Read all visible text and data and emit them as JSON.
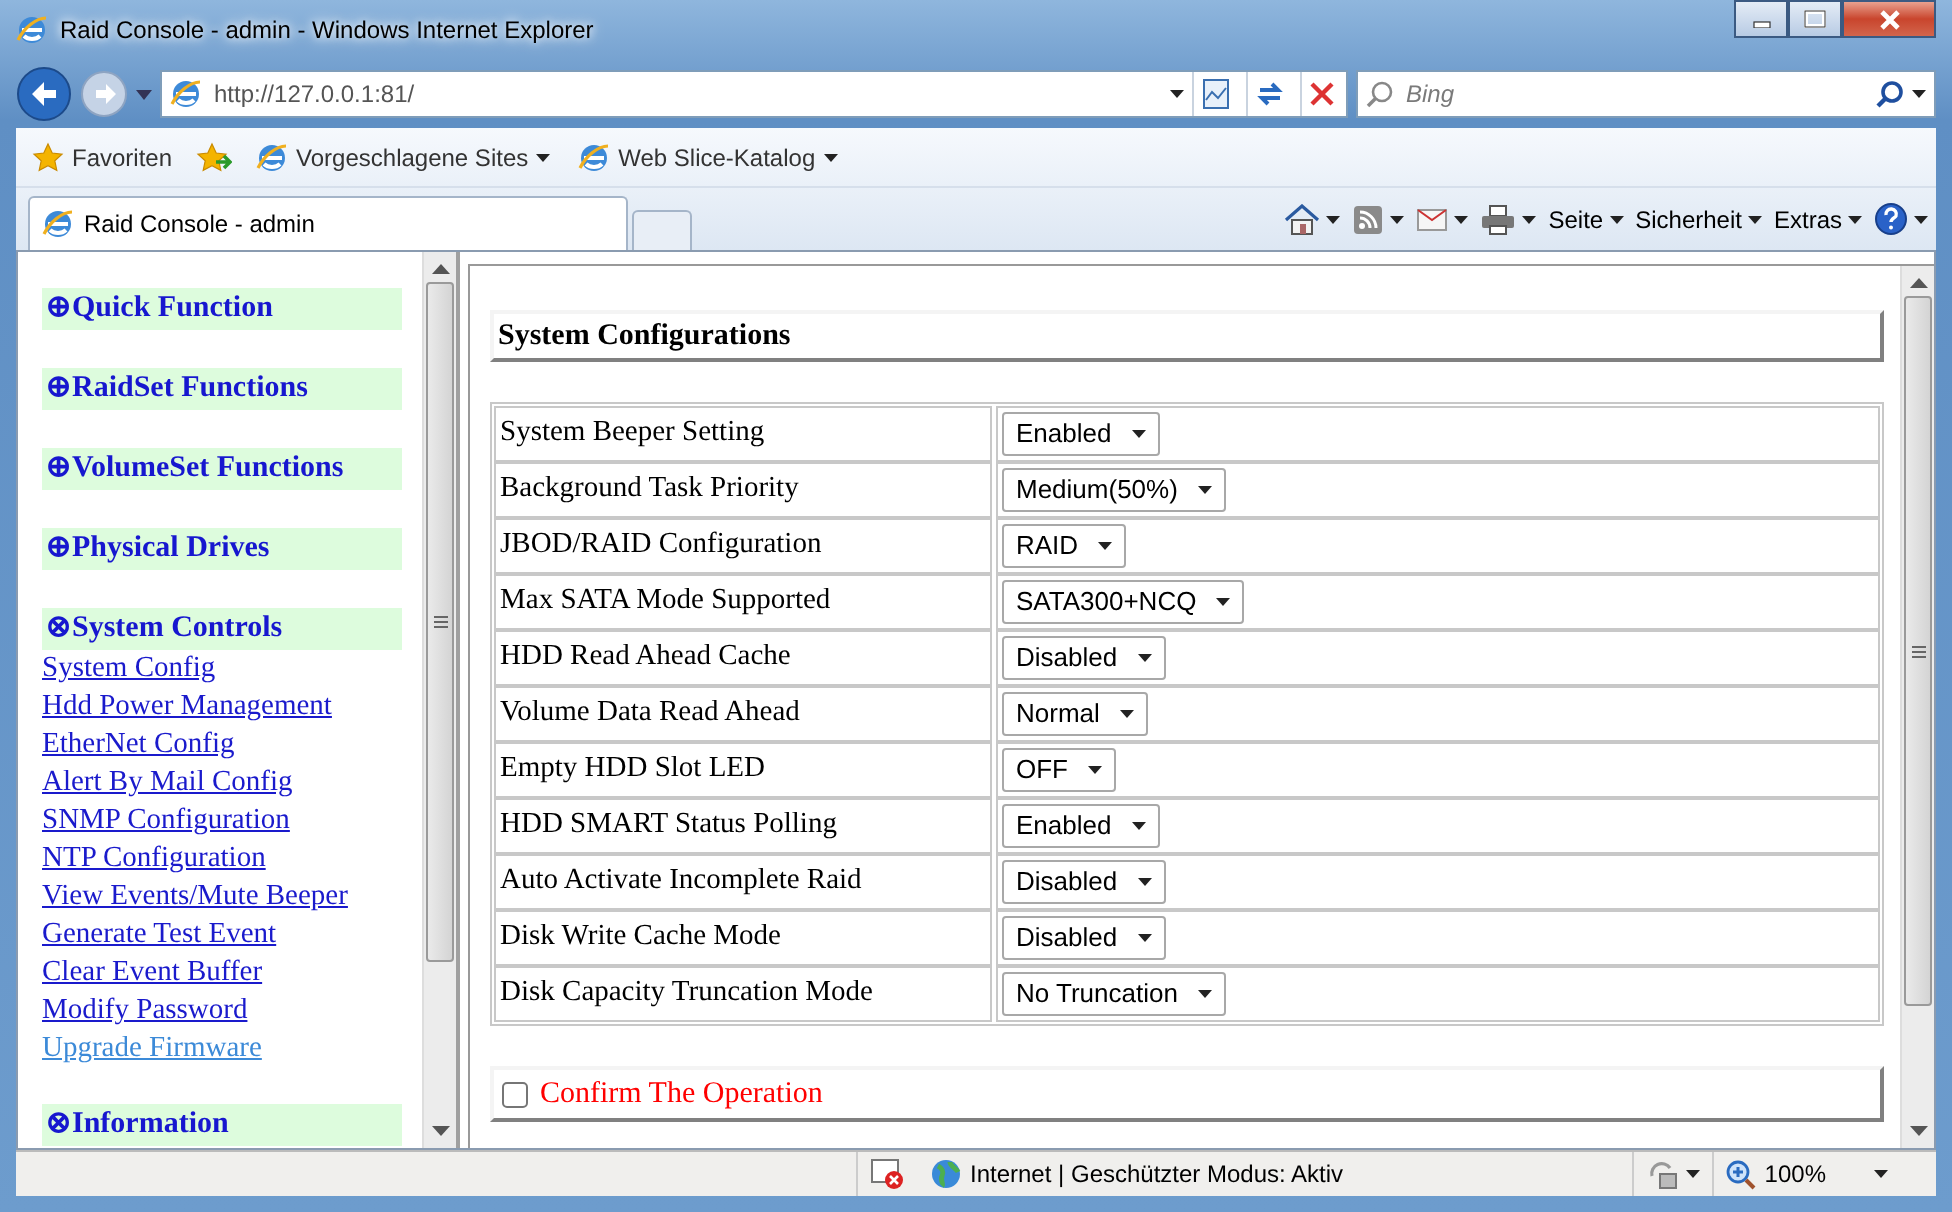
{
  "window": {
    "title": "Raid Console - admin - Windows Internet Explorer"
  },
  "address": {
    "url": "http://127.0.0.1:81/"
  },
  "search": {
    "placeholder": "Bing"
  },
  "favorites_bar": [
    "Favoriten",
    "Vorgeschlagene Sites",
    "Web Slice-Katalog"
  ],
  "tabs": [
    {
      "label": "Raid Console - admin",
      "selected": true
    }
  ],
  "menus": [
    "Seite",
    "Sicherheit",
    "Extras"
  ],
  "sidebar": {
    "sections": [
      {
        "marker": "⊕",
        "label": "Quick Function",
        "expanded": false
      },
      {
        "marker": "⊕",
        "label": "RaidSet Functions",
        "expanded": false
      },
      {
        "marker": "⊕",
        "label": "VolumeSet Functions",
        "expanded": false
      },
      {
        "marker": "⊕",
        "label": "Physical Drives",
        "expanded": false
      },
      {
        "marker": "⊗",
        "label": "System Controls",
        "expanded": true,
        "children": [
          {
            "label": "System Config",
            "hover": false
          },
          {
            "label": "Hdd Power Management",
            "hover": false
          },
          {
            "label": "EtherNet Config",
            "hover": false
          },
          {
            "label": "Alert By Mail Config",
            "hover": false
          },
          {
            "label": "SNMP Configuration",
            "hover": false
          },
          {
            "label": "NTP Configuration",
            "hover": false
          },
          {
            "label": "View Events/Mute Beeper",
            "hover": false
          },
          {
            "label": "Generate Test Event",
            "hover": false
          },
          {
            "label": "Clear Event Buffer",
            "hover": false
          },
          {
            "label": "Modify Password",
            "hover": false
          },
          {
            "label": "Upgrade Firmware",
            "hover": true
          }
        ]
      },
      {
        "marker": "⊗",
        "label": "Information"
      }
    ]
  },
  "panel": {
    "title": "System Configurations",
    "settings": [
      {
        "label": "System Beeper Setting",
        "value": "Enabled"
      },
      {
        "label": "Background Task Priority",
        "value": "Medium(50%)"
      },
      {
        "label": "JBOD/RAID Configuration",
        "value": "RAID"
      },
      {
        "label": "Max SATA Mode Supported",
        "value": "SATA300+NCQ"
      },
      {
        "label": "HDD Read Ahead Cache",
        "value": "Disabled"
      },
      {
        "label": "Volume Data Read Ahead",
        "value": "Normal"
      },
      {
        "label": "Empty HDD Slot LED",
        "value": "OFF"
      },
      {
        "label": "HDD SMART Status Polling",
        "value": "Enabled"
      },
      {
        "label": "Auto Activate Incomplete Raid",
        "value": "Disabled"
      },
      {
        "label": "Disk Write Cache Mode",
        "value": "Disabled"
      },
      {
        "label": "Disk Capacity Truncation Mode",
        "value": "No Truncation"
      }
    ],
    "confirm": {
      "label": "Confirm The Operation",
      "checked": false
    }
  },
  "status_bar": {
    "text": "Internet | Geschützter Modus: Aktiv",
    "zoom": "100%"
  }
}
